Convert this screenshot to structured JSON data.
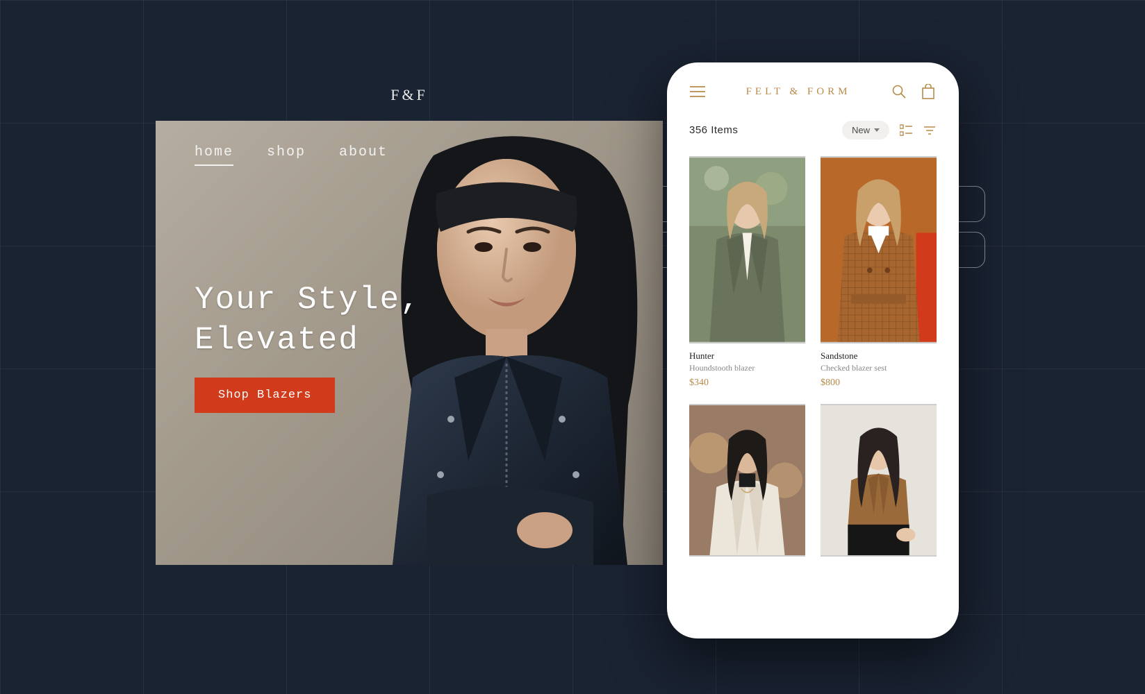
{
  "desktop": {
    "logo": "F&F",
    "nav": {
      "home": "home",
      "shop": "shop",
      "about": "about"
    },
    "headline": "Your Style,\nElevated",
    "cta": "Shop Blazers"
  },
  "mobile": {
    "brand": "FELT & FORM",
    "items_count": "356 Items",
    "sort_label": "New",
    "products": [
      {
        "name": "Hunter",
        "desc": "Houndstooth blazer",
        "price": "$340"
      },
      {
        "name": "Sandstone",
        "desc": "Checked blazer sest",
        "price": "$800"
      },
      {
        "name": "",
        "desc": "",
        "price": ""
      },
      {
        "name": "",
        "desc": "",
        "price": ""
      }
    ]
  },
  "colors": {
    "accent": "#d13a1a",
    "gold": "#b88a4a",
    "bg": "#1a2332"
  }
}
